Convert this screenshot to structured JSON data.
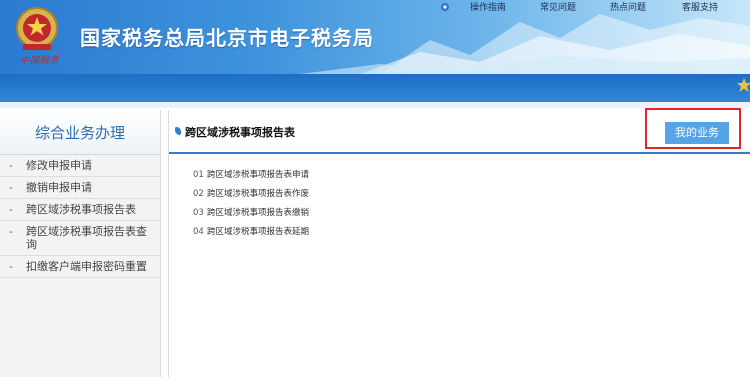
{
  "header": {
    "title": "国家税务总局北京市电子税务局",
    "emblem_text": "中国税务",
    "top_links": [
      "操作指南",
      "常见问题",
      "热点问题",
      "客服支持"
    ]
  },
  "sidebar": {
    "title": "综合业务办理",
    "items": [
      "修改申报申请",
      "撤销申报申请",
      "跨区域涉税事项报告表",
      "跨区域涉税事项报告表查询",
      "扣缴客户端申报密码重置"
    ]
  },
  "main": {
    "title": "跨区域涉税事项报告表",
    "button_label": "我的业务",
    "links": [
      {
        "num": "01",
        "label": "跨区域涉税事项报告表申请"
      },
      {
        "num": "02",
        "label": "跨区域涉税事项报告表作废"
      },
      {
        "num": "03",
        "label": "跨区域涉税事项报告表缴销"
      },
      {
        "num": "04",
        "label": "跨区域涉税事项报告表延期"
      }
    ]
  },
  "colors": {
    "accent": "#2e7fcc",
    "button": "#55a5e6",
    "highlight_box": "#e5252a"
  }
}
